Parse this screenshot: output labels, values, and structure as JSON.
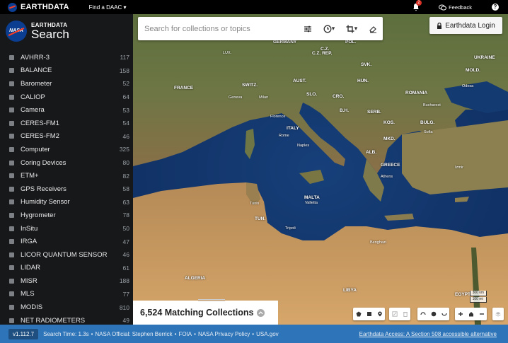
{
  "topbar": {
    "brand": "EARTHDATA",
    "find_daac": "Find a DAAC",
    "notification_count": "2",
    "feedback": "Feedback",
    "help": "?"
  },
  "sidebar": {
    "logo_caption": "EARTHDATA",
    "logo_title": "Search",
    "logo_badge": "NASA",
    "facets": [
      {
        "label": "AVHRR-3",
        "count": "117"
      },
      {
        "label": "BALANCE",
        "count": "158"
      },
      {
        "label": "Barometer",
        "count": "52"
      },
      {
        "label": "CALIOP",
        "count": "64"
      },
      {
        "label": "Camera",
        "count": "53"
      },
      {
        "label": "CERES-FM1",
        "count": "54"
      },
      {
        "label": "CERES-FM2",
        "count": "46"
      },
      {
        "label": "Computer",
        "count": "325"
      },
      {
        "label": "Coring Devices",
        "count": "80"
      },
      {
        "label": "ETM+",
        "count": "82"
      },
      {
        "label": "GPS Receivers",
        "count": "58"
      },
      {
        "label": "Humidity Sensor",
        "count": "63"
      },
      {
        "label": "Hygrometer",
        "count": "78"
      },
      {
        "label": "InSitu",
        "count": "50"
      },
      {
        "label": "IRGA",
        "count": "47"
      },
      {
        "label": "LICOR QUANTUM SENSOR",
        "count": "46"
      },
      {
        "label": "LIDAR",
        "count": "61"
      },
      {
        "label": "MISR",
        "count": "188"
      },
      {
        "label": "MLS",
        "count": "77"
      },
      {
        "label": "MODIS",
        "count": "810"
      },
      {
        "label": "NET RADIOMETERS",
        "count": "49"
      }
    ]
  },
  "search": {
    "placeholder": "Search for collections or topics"
  },
  "login": {
    "label": "Earthdata Login"
  },
  "results": {
    "matching": "6,524 Matching Collections"
  },
  "map": {
    "labels": [
      "GERMANY",
      "C.Z.",
      "POL.",
      "LUX.",
      "C.Z. REP.",
      "UKRAINE",
      "MOLD.",
      "FRANCE",
      "AUST.",
      "HUN.",
      "SWITZ.",
      "SVK.",
      "Geneva",
      "Milan",
      "SLO.",
      "ROMANIA",
      "Odesa",
      "CRO.",
      "B.H.",
      "SERB.",
      "BULG.",
      "ITALY",
      "KOS.",
      "Sofia",
      "MKD.",
      "Rome",
      "Naples",
      "ALB.",
      "GREECE",
      "MALTA",
      "TUN.",
      "Tunis",
      "Tripoli",
      "ALGERIA",
      "LIBYA",
      "EGYPT",
      "Bucharest",
      "Florence",
      "Izmir",
      "Athens",
      "Benghazi",
      "Valletta"
    ],
    "scale_km": "300 km",
    "scale_mi": "100 mi"
  },
  "footer": {
    "version": "v1.112.7",
    "search_time": "Search Time: 1.3s",
    "official": "NASA Official: Stephen Berrick",
    "foia": "FOIA",
    "privacy": "NASA Privacy Policy",
    "usagov": "USA.gov",
    "accessibility": "Earthdata Access: A Section 508 accessible alternative"
  }
}
